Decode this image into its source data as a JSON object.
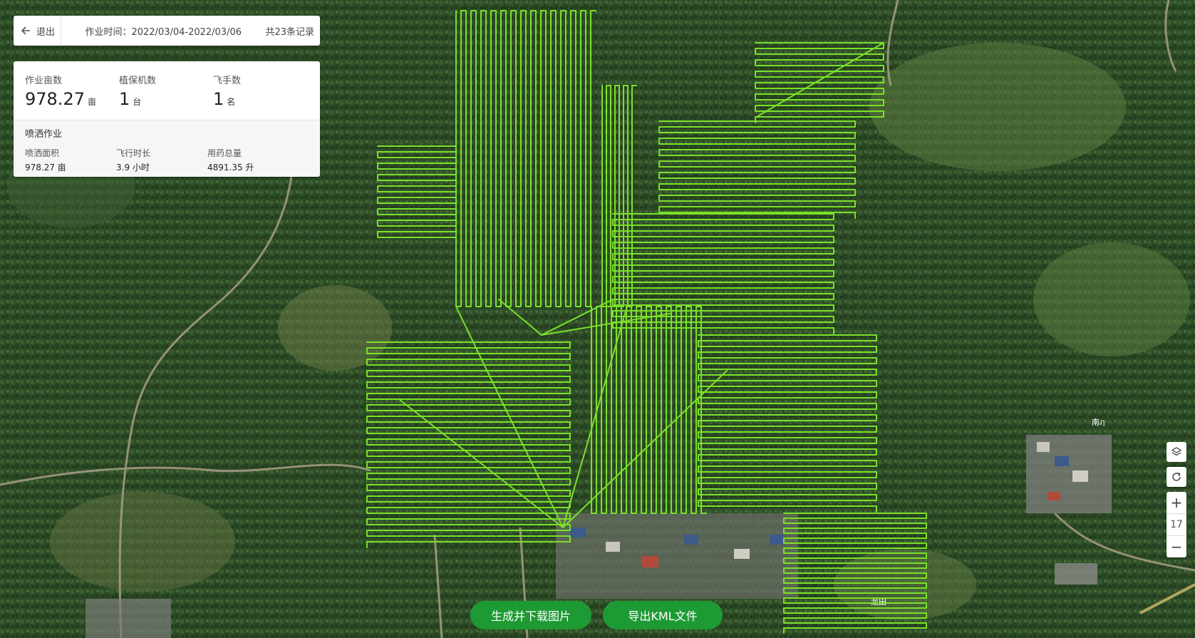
{
  "header": {
    "back_label": "退出",
    "time_text": "作业时间：2022/03/04-2022/03/06",
    "records_text": "共23条记录"
  },
  "summary": {
    "area": {
      "label": "作业亩数",
      "value": "978.27",
      "unit": "亩"
    },
    "machines": {
      "label": "植保机数",
      "value": "1",
      "unit": "台"
    },
    "pilots": {
      "label": "飞手数",
      "value": "1",
      "unit": "名"
    }
  },
  "spray": {
    "title": "喷洒作业",
    "area": {
      "label": "喷洒面积",
      "value": "978.27 亩"
    },
    "flight_time": {
      "label": "飞行时长",
      "value": "3.9 小时"
    },
    "pesticide": {
      "label": "用药总量",
      "value": "4891.35 升"
    }
  },
  "map": {
    "zoom_level": "17",
    "zoom_in": "+",
    "zoom_out": "−",
    "place_labels": [
      "南ฦ",
      "龙田"
    ],
    "track_color": "#7ce02a"
  },
  "actions": {
    "generate_image": "生成并下载图片",
    "export_kml": "导出KML文件"
  }
}
